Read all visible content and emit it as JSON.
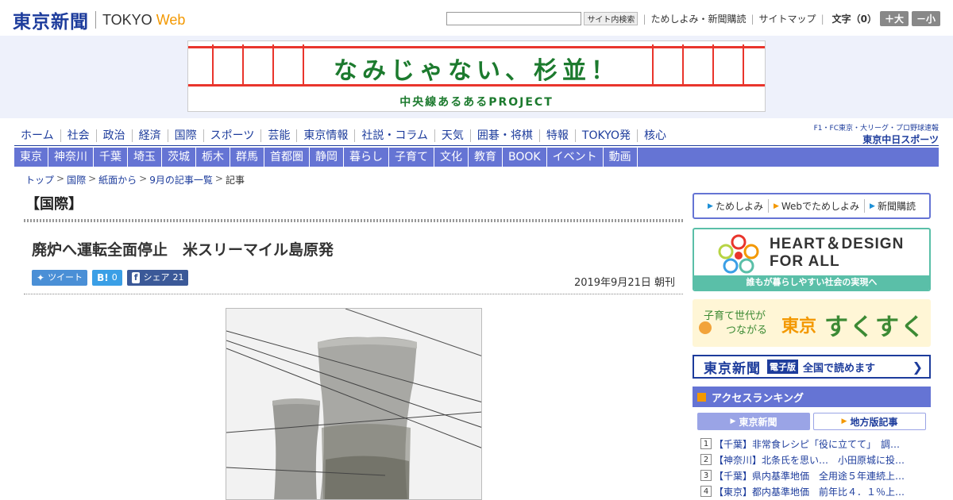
{
  "header": {
    "logo_mark": "東京新聞",
    "logo_tokyo": "TOKYO",
    "logo_web": "Web",
    "search_placeholder": "",
    "search_button": "サイト内検索",
    "util_link_1": "ためしよみ・新聞購読",
    "util_link_2": "サイトマップ",
    "font_label": "文字（0）",
    "font_larger": "＋大",
    "font_smaller": "－小"
  },
  "banner": {
    "title": "なみじゃない、杉並！",
    "subtitle": "中央線あるあるPROJECT"
  },
  "main_nav": [
    "ホーム",
    "社会",
    "政治",
    "経済",
    "国際",
    "スポーツ",
    "芸能",
    "東京情報",
    "社説・コラム",
    "天気",
    "囲碁・将棋",
    "特報",
    "TOKYO発",
    "核心"
  ],
  "sports_ad": {
    "top": "F1・FC東京・大リーグ・プロ野球速報",
    "bottom": "東京中日スポーツ"
  },
  "sub_nav": [
    "東京",
    "神奈川",
    "千葉",
    "埼玉",
    "茨城",
    "栃木",
    "群馬",
    "首都圏",
    "静岡",
    "暮らし",
    "子育て",
    "文化",
    "教育",
    "BOOK",
    "イベント",
    "動画"
  ],
  "breadcrumb": {
    "items": [
      "トップ",
      "国際",
      "紙面から",
      "9月の記事一覧"
    ],
    "current": "記事",
    "separator": ">"
  },
  "article": {
    "section": "【国際】",
    "title": "廃炉へ運転全面停止　米スリーマイル島原発",
    "date": "2019年9月21日 朝刊",
    "share": {
      "tweet_label": "ツイート",
      "hatena_icon": "B!",
      "hatena_count": "0",
      "fb_label": "シェア",
      "fb_count": "21"
    }
  },
  "sidebar": {
    "subscribe": [
      "ためしよみ",
      "Webでためしよみ",
      "新聞購読"
    ],
    "heart_title_line1": "HEART＆DESIGN",
    "heart_title_line2": "FOR ALL",
    "heart_caption": "誰もが暮らしやすい社会の実現へ",
    "suku_line1": "子育て世代が",
    "suku_line2": "つながる",
    "suku_tokyo": "東京",
    "suku_name": "すくすく",
    "digital_logo": "東京新聞",
    "digital_tag": "電子版",
    "digital_text": "全国で読めます",
    "ranking_title": "アクセスランキング",
    "ranking_tab_active": "東京新聞",
    "ranking_tab_inactive": "地方版記事",
    "ranking": [
      {
        "num": "1",
        "text": "【千葉】非常食レシピ「役に立てて」　調…"
      },
      {
        "num": "2",
        "text": "【神奈川】北条氏を思い…　小田原城に投…"
      },
      {
        "num": "3",
        "text": "【千葉】県内基準地価　全用途５年連続上…"
      },
      {
        "num": "4",
        "text": "【東京】都内基準地価　前年比４．１％上…"
      }
    ]
  },
  "colors": {
    "brand_blue": "#1d3c9c",
    "nav_purple": "#6574d4",
    "accent_orange": "#f39800",
    "banner_green": "#1c7a2e",
    "banner_red": "#e9352c"
  }
}
